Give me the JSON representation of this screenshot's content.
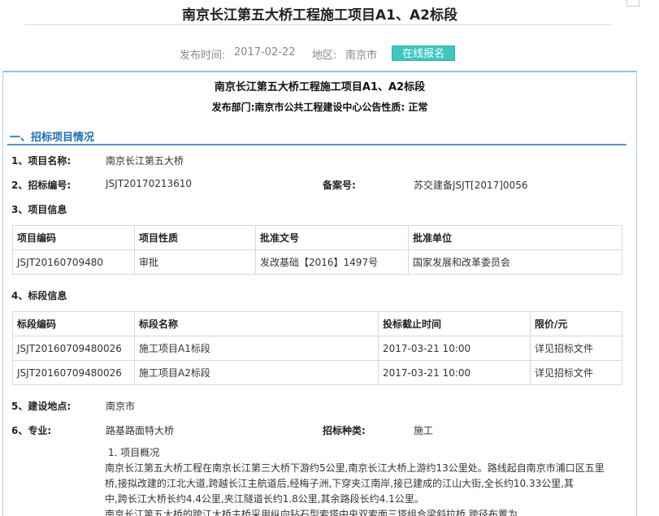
{
  "page_title": "南京长江第五大桥工程施工项目A1、A2标段",
  "meta": {
    "publish_label": "发布时间:",
    "publish_date": "2017-02-22",
    "region_label": "地区:",
    "region": "南京市",
    "signup_button": "在线报名"
  },
  "doc": {
    "title": "南京长江第五大桥工程施工项目A1、A2标段",
    "subtitle": "发布部门:南京市公共工程建设中心公告性质: 正常"
  },
  "section": {
    "heading": "一、招标项目情况"
  },
  "rows": {
    "project_name_label": "1、项目名称:",
    "project_name": "南京长江第五大桥",
    "bid_no_label": "2、招标编号:",
    "bid_no": "JSJT20170213610",
    "record_no_label": "备案号:",
    "record_no": "苏交建备JSJT[2017]0056",
    "project_info_label": "3、项目信息",
    "tender_info_label": "4、标段信息",
    "location_label": "5、建设地点:",
    "location": "南京市",
    "specialty_label": "6、专业:",
    "specialty": "路基路面特大桥",
    "bid_type_label": "招标种类:",
    "bid_type": "施工"
  },
  "project_table": {
    "headers": [
      "项目编码",
      "项目性质",
      "批准文号",
      "批准单位"
    ],
    "row": [
      "JSJT20160709480",
      "审批",
      "发改基础【2016】1497号",
      "国家发展和改革委员会"
    ]
  },
  "tender_table": {
    "headers": [
      "标段编码",
      "标段名称",
      "投标截止时间",
      "限价/元"
    ],
    "rows": [
      [
        "JSJT20160709480026",
        "施工项目A1标段",
        "2017-03-21 10:00",
        "详见招标文件"
      ],
      [
        "JSJT20160709480026",
        "施工项目A2标段",
        "2017-03-21 10:00",
        "详见招标文件"
      ]
    ]
  },
  "overview": {
    "heading": "1. 项目概况",
    "line1": "南京长江第五大桥工程在南京长江第三大桥下游约5公里,南京长江大桥上游约13公里处。路线起自南京市浦口区五里",
    "line2": "桥,接拟改建的江北大道,跨越长江主航道后,经梅子洲,下穿夹江南岸,接已建成的江山大街,全长约10.33公里,其",
    "line3": "中,跨长江大桥长约4.4公里,夹江隧道长约1.8公里,其余路段长约4.1公里。",
    "line4": "南京长江第五大桥的跨江大桥主桥采用纵向钻石型索塔中央双索面三塔组合梁斜拉桥,跨径布置为"
  }
}
